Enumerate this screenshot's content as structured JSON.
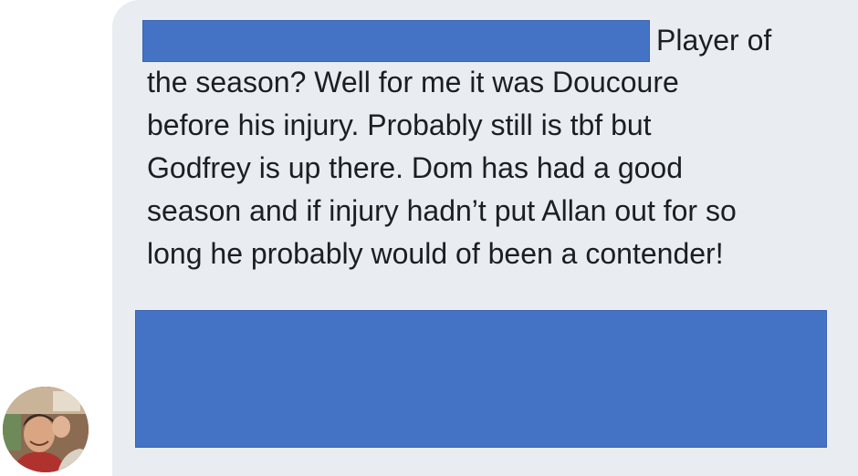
{
  "message": {
    "first_line_tail": "Player of",
    "lines": [
      "the season? Well for me it was Doucoure",
      "before his injury. Probably still is tbf but",
      "Godfrey is up there. Dom has had a good",
      "season and if injury hadn’t put Allan out for so",
      "long he probably would of been a contender!"
    ]
  },
  "colors": {
    "bubble_bg": "#e9ecf0",
    "redaction": "#4472c4",
    "text": "#1c1e21"
  },
  "icons": {
    "avatar": "user-avatar-photo"
  }
}
